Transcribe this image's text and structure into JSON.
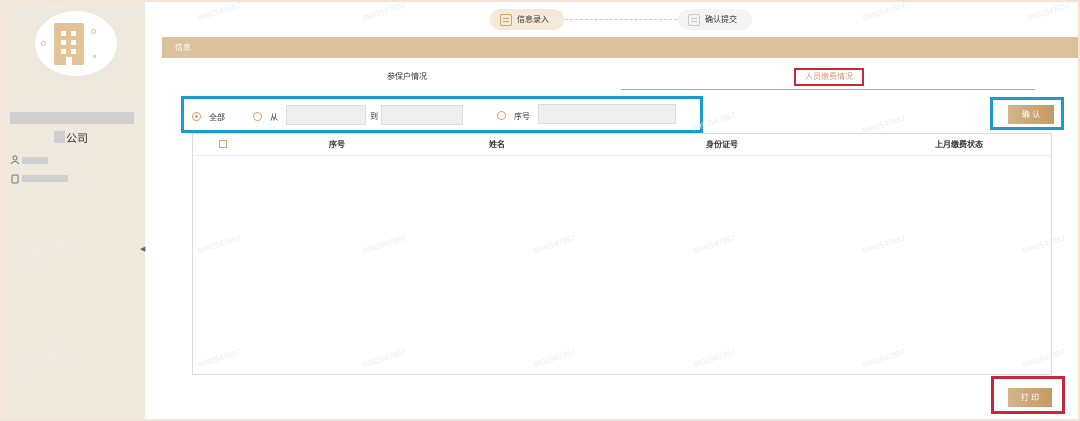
{
  "sidebar": {
    "company_suffix": "公司",
    "collapse_glyph": "◀"
  },
  "stepper": {
    "step1_label": "信息录入",
    "step2_label": "确认提交"
  },
  "section": {
    "title": "信息"
  },
  "tabs": [
    {
      "label": "参保户情况",
      "active": false
    },
    {
      "label": "人员缴费情况",
      "active": true
    }
  ],
  "filter": {
    "all_label": "全部",
    "from_label": "从",
    "to_label": "到",
    "serial_label": "序号",
    "from_value": "",
    "to_value": "",
    "serial_value": ""
  },
  "buttons": {
    "confirm": "确 认",
    "print": "打 印"
  },
  "table": {
    "columns": [
      "序号",
      "姓名",
      "身份证号",
      "上月缴费状态"
    ],
    "rows": []
  },
  "watermark": "9992547857",
  "colors": {
    "accent_gold": "#dcc29c",
    "highlight_blue": "#1a9bd0",
    "highlight_red": "#c8283a"
  }
}
